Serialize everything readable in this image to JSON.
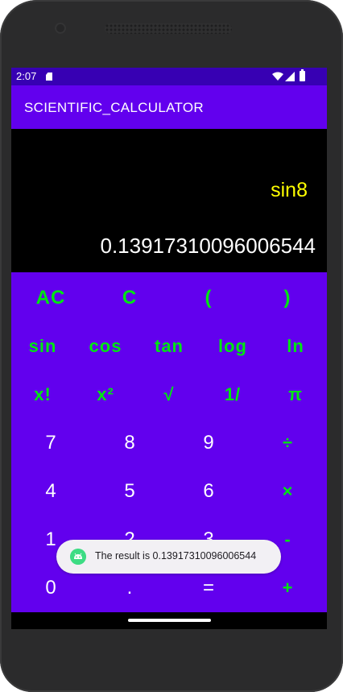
{
  "status_bar": {
    "time": "2:07",
    "icons": [
      "sd-card-icon",
      "wifi-icon",
      "signal-icon",
      "battery-icon"
    ]
  },
  "app_bar": {
    "title": "SCIENTIFIC_CALCULATOR"
  },
  "display": {
    "expression": "sin8",
    "result": "0.13917310096006544"
  },
  "keypad": {
    "rows": [
      [
        "AC",
        "C",
        "(",
        ")"
      ],
      [
        "sin",
        "cos",
        "tan",
        "log",
        "ln"
      ],
      [
        "x!",
        "x²",
        "√",
        "1/",
        "π"
      ],
      [
        "7",
        "8",
        "9",
        "÷"
      ],
      [
        "4",
        "5",
        "6",
        "×"
      ],
      [
        "1",
        "2",
        "3",
        "-"
      ],
      [
        "0",
        ".",
        "=",
        "+"
      ]
    ]
  },
  "toast": {
    "text": "The result is 0.13917310096006544",
    "icon": "android-icon"
  },
  "colors": {
    "status_bar": "#3700b3",
    "primary": "#6200ee",
    "function_key": "#00e613",
    "expression": "#ffff00",
    "result": "#ffffff"
  }
}
